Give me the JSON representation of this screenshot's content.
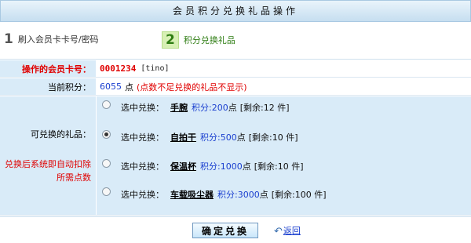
{
  "page": {
    "title": "会员积分兑换礼品操作"
  },
  "steps": [
    {
      "num": "1",
      "label": "刷入会员卡卡号/密码"
    },
    {
      "num": "2",
      "label": "积分兑换礼品"
    }
  ],
  "member": {
    "card_label": "操作的会员卡号：",
    "card_no": "0001234",
    "card_name": "[tino]",
    "points_label": "当前积分：",
    "points_value": "6055",
    "points_unit": "点",
    "points_note": "(点数不足兑换的礼品不显示)"
  },
  "gifts_section": {
    "label": "可兑换的礼品：",
    "deduct_note": "兑换后系统即自动扣除所需点数",
    "selected_index": 1,
    "items": [
      {
        "prefix": "选中兑换：",
        "name": "手腕",
        "points_label": "积分:",
        "points": "200",
        "unit": "点",
        "stock": "[剩余:12 件]"
      },
      {
        "prefix": "选中兑换：",
        "name": "自拍干",
        "points_label": "积分:",
        "points": "500",
        "unit": "点",
        "stock": "[剩余:10 件]"
      },
      {
        "prefix": "选中兑换：",
        "name": "保温杯",
        "points_label": "积分:",
        "points": "1000",
        "unit": "点",
        "stock": "[剩余:10 件]"
      },
      {
        "prefix": "选中兑换：",
        "name": "车载吸尘器",
        "points_label": "积分:",
        "points": "3000",
        "unit": "点",
        "stock": "[剩余:100 件]"
      }
    ]
  },
  "actions": {
    "confirm_label": "确定兑换",
    "back_label": "返回",
    "back_icon": "return-arrow-icon"
  },
  "colors": {
    "label_bg": "#d9ebf8",
    "alert_red": "#e00000",
    "value_blue": "#1a3fcf",
    "step_green": "#2e7d12"
  }
}
